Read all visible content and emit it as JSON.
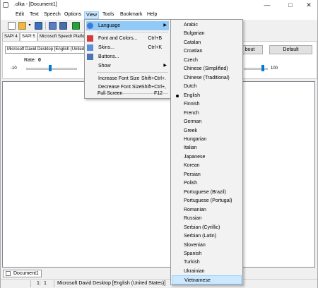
{
  "window": {
    "title": ".olka - [Document1]",
    "min_glyph": "—",
    "max_glyph": "□",
    "close_glyph": "✕"
  },
  "menubar": [
    "Edit",
    "Text",
    "Speech",
    "Options",
    "View",
    "Tools",
    "Bookmark",
    "Help"
  ],
  "toolbar_icons": [
    "new-document-icon",
    "open-folder-icon",
    "dropdown-icon",
    "save-icon",
    "copy-icon",
    "paste-icon",
    "play-icon"
  ],
  "tabs": [
    "SAPI 4",
    "SAPI 5",
    "Microsoft Speech Platform"
  ],
  "panel": {
    "voice": "Microsoft David Desktop [English (United",
    "about_label": "bout",
    "default_label": "Default",
    "rate_label": "Rate:",
    "rate_value": "0",
    "rate_min": "-10",
    "pitch_max": "100"
  },
  "view_menu": [
    {
      "label": "Language",
      "shortcut": "",
      "submenu": true,
      "icon": "language-icon",
      "highlighted": true
    },
    {
      "separator": true
    },
    {
      "label": "Font and Colors...",
      "shortcut": "Ctrl+B",
      "icon": "font-colors-icon"
    },
    {
      "label": "Skins...",
      "shortcut": "Ctrl+K",
      "icon": "skins-icon"
    },
    {
      "label": "Buttons...",
      "shortcut": "",
      "icon": "buttons-icon"
    },
    {
      "label": "Show",
      "shortcut": "",
      "submenu": true,
      "icon": ""
    },
    {
      "separator": true
    },
    {
      "label": "Increase Font Size",
      "shortcut": "Shift+Ctrl+.",
      "icon": ""
    },
    {
      "label": "Decrease Font Size",
      "shortcut": "Shift+Ctrl+,",
      "icon": ""
    },
    {
      "separator": true
    },
    {
      "label": "Full Screen",
      "shortcut": "F12",
      "icon": ""
    }
  ],
  "languages": [
    "Arabic",
    "Bulgarian",
    "Catalan",
    "Croatian",
    "Czech",
    "Chinese (Simplified)",
    "Chinese (Traditional)",
    "Dutch",
    "English",
    "Finnish",
    "French",
    "German",
    "Greek",
    "Hungarian",
    "Italian",
    "Japanese",
    "Korean",
    "Persian",
    "Polish",
    "Portuguese (Brazil)",
    "Portuguese (Portugal)",
    "Romanian",
    "Russian",
    "Serbian (Cyrillic)",
    "Serbian (Latin)",
    "Slovenian",
    "Spanish",
    "Turkish",
    "Ukrainian",
    "Vietnamese"
  ],
  "current_language": "English",
  "hovered_language": "Vietnamese",
  "document_tab": "Document1",
  "status": {
    "line": "1:",
    "col": "1",
    "voice": "Microsoft David Desktop [English (United States)]"
  },
  "colors": {
    "accent": "#0078d7",
    "menu_highlight": "#91c9f7",
    "hover": "#cce8ff"
  }
}
